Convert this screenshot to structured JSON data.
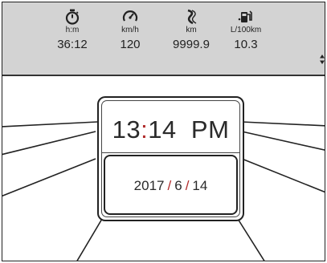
{
  "stats": [
    {
      "icon": "stopwatch-icon",
      "unit": "h:m",
      "value": "36:12"
    },
    {
      "icon": "speedometer-icon",
      "unit": "km/h",
      "value": "120"
    },
    {
      "icon": "road-icon",
      "unit": "km",
      "value": "9999.9"
    },
    {
      "icon": "fuel-pump-icon",
      "unit": "L/100km",
      "value": "10.3"
    }
  ],
  "clock": {
    "hour": "13",
    "minute": "14",
    "ampm": "PM"
  },
  "date": {
    "year": "2017",
    "month": "6",
    "day": "14"
  },
  "colors": {
    "topbar_bg": "#d3d3d3",
    "accent": "#b02a2a",
    "text": "#2a2a2a"
  }
}
